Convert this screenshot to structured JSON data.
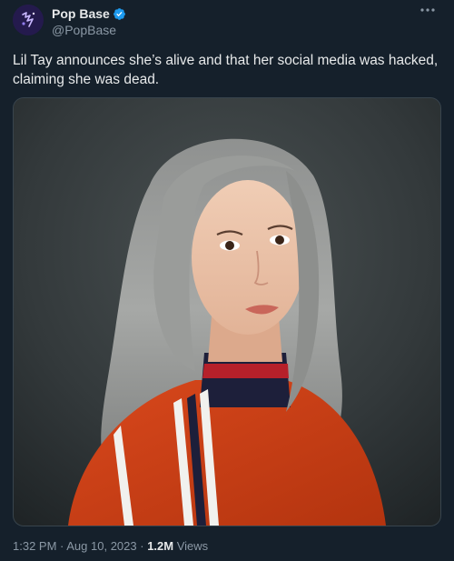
{
  "author": {
    "display_name": "Pop Base",
    "handle": "@PopBase",
    "verified": true,
    "avatar_icon": "pop-base-logo-icon"
  },
  "tweet": {
    "text": "Lil Tay announces she’s alive and that her social media was hacked, claiming she was dead."
  },
  "meta": {
    "time": "1:32 PM",
    "separator": " · ",
    "date": "Aug 10, 2023",
    "views_count": "1.2M",
    "views_label": "Views"
  },
  "colors": {
    "background": "#15202b",
    "text_primary": "#e7e9ea",
    "text_secondary": "#8b98a5",
    "verified_badge": "#1d9bf0",
    "border": "#38444d"
  },
  "icons": {
    "verified": "verified-badge-icon",
    "more": "more-options-icon"
  }
}
